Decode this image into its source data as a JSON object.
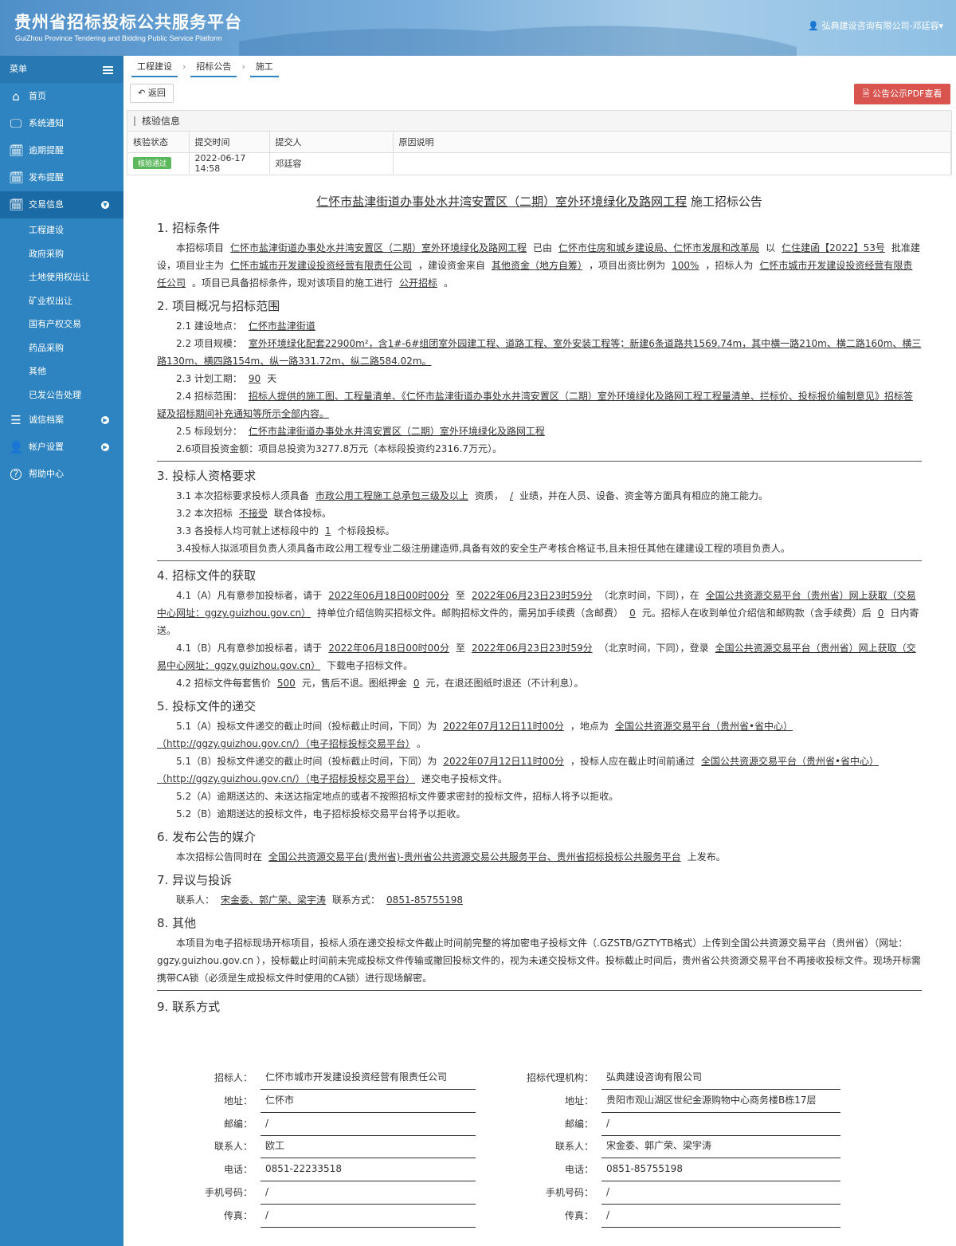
{
  "header": {
    "title": "贵州省招标投标公共服务平台",
    "subtitle": "GuiZhou Province Tendering and Bidding Public Service Platform",
    "user": "弘典建设咨询有限公司-邓廷容"
  },
  "sidebar": {
    "menu_label": "菜单",
    "items": [
      {
        "label": "首页",
        "icon": "home-icon"
      },
      {
        "label": "系统通知",
        "icon": "monitor-icon"
      },
      {
        "label": "逾期提醒",
        "icon": "calendar-icon"
      },
      {
        "label": "发布提醒",
        "icon": "calendar-icon"
      },
      {
        "label": "交易信息",
        "icon": "calendar-icon",
        "active": true
      }
    ],
    "sub_items": [
      "工程建设",
      "政府采购",
      "土地使用权出让",
      "矿业权出让",
      "国有产权交易",
      "药品采购",
      "其他",
      "已发公告处理"
    ],
    "items2": [
      {
        "label": "诚信档案",
        "icon": "list-icon"
      },
      {
        "label": "帐户设置",
        "icon": "user-icon"
      },
      {
        "label": "帮助中心",
        "icon": "help-icon"
      }
    ]
  },
  "breadcrumb": [
    "工程建设",
    "招标公告",
    "施工"
  ],
  "buttons": {
    "back": "返回",
    "pdf": "公告公示PDF查看"
  },
  "verify": {
    "title": "核验信息",
    "headers": [
      "核验状态",
      "提交时间",
      "提交人",
      "原因说明"
    ],
    "row": {
      "status": "核验通过",
      "time": "2022-06-17 14:58",
      "submitter": "邓廷容",
      "reason": ""
    }
  },
  "doc": {
    "title_project": "仁怀市盐津街道办事处水井湾安置区（二期）室外环境绿化及路网工程",
    "title_suffix": "施工招标公告",
    "s1": "1. 招标条件",
    "s1_p": [
      "本招标项目",
      "仁怀市盐津街道办事处水井湾安置区（二期）室外环境绿化及路网工程",
      "已由",
      "仁怀市住房和城乡建设局、仁怀市发展和改革局",
      "以",
      "仁住建函【2022】53号",
      "批准建设，项目业主为",
      "仁怀市城市开发建设投资经营有限责任公司",
      "，建设资金来自",
      "其他资金（地方自筹）",
      "，项目出资比例为",
      "100%",
      "，招标人为",
      "仁怀市城市开发建设投资经营有限责任公司",
      "。项目已具备招标条件，现对该项目的施工进行",
      "公开招标",
      "。"
    ],
    "s2": "2. 项目概况与招标范围",
    "s2_1": [
      "2.1  建设地点：",
      "仁怀市盐津街道"
    ],
    "s2_2": [
      "2.2  项目规模：",
      "室外环境绿化配套22900m²，含1#-6#组团室外园建工程、道路工程、室外安装工程等；新建6条道路共1569.74m，其中横一路210m、横二路160m、横三路130m、横四路154m、纵一路331.72m、纵二路584.02m。"
    ],
    "s2_3": [
      "2.3  计划工期：",
      "90",
      "天"
    ],
    "s2_4": [
      "2.4  招标范围：",
      "招标人提供的施工图、工程量清单、《仁怀市盐津街道办事处水井湾安置区（二期）室外环境绿化及路网工程工程量清单、拦标价、投标报价编制意见》招标答疑及招标期间补充通知等所示全部内容。"
    ],
    "s2_5": [
      "2.5  标段划分：",
      "仁怀市盐津街道办事处水井湾安置区（二期）室外环境绿化及路网工程"
    ],
    "s2_6": "2.6项目投资金额：项目总投资为3277.8万元（本标段投资约2316.7万元）。",
    "s3": "3. 投标人资格要求",
    "s3_1": [
      "3.1  本次招标要求投标人须具备",
      "市政公用工程施工总承包三级及以上",
      "资质，",
      "/",
      "业绩，并在人员、设备、资金等方面具有相应的施工能力。"
    ],
    "s3_2": [
      "3.2  本次招标",
      "不接受",
      "联合体投标。"
    ],
    "s3_3": [
      "3.3  各投标人均可就上述标段中的",
      "1",
      "个标段投标。"
    ],
    "s3_4": "3.4投标人拟派项目负责人须具备市政公用工程专业二级注册建造师,具备有效的安全生产考核合格证书,且未担任其他在建建设工程的项目负责人。",
    "s4": "4. 招标文件的获取",
    "s4_1a": [
      "4.1（A）凡有意参加投标者，请于",
      "2022年06月18日00时00分",
      "至",
      "2022年06月23日23时59分",
      "（北京时间，下同），在",
      "全国公共资源交易平台（贵州省）网上获取（交易中心网址：ggzy.guizhou.gov.cn）",
      "持单位介绍信购买招标文件。邮购招标文件的，需另加手续费（含邮费）",
      "0",
      "元。招标人在收到单位介绍信和邮购款（含手续费）后",
      "0",
      "日内寄送。"
    ],
    "s4_1b": [
      "4.1（B）凡有意参加投标者，请于",
      "2022年06月18日00时00分",
      "至",
      "2022年06月23日23时59分",
      "（北京时间，下同），登录",
      "全国公共资源交易平台（贵州省）网上获取（交易中心网址：ggzy.guizhou.gov.cn）",
      "下载电子招标文件。"
    ],
    "s4_2": [
      "4.2  招标文件每套售价",
      "500",
      "元，售后不退。图纸押金",
      "0",
      "元，在退还图纸时退还（不计利息）。"
    ],
    "s5": "5. 投标文件的递交",
    "s5_1a": [
      "5.1（A）投标文件递交的截止时间（投标截止时间，下同）为",
      "2022年07月12日11时00分",
      "，地点为",
      "全国公共资源交易平台（贵州省•省中心）（http://ggzy.guizhou.gov.cn/）（电子招标投标交易平台）",
      "。"
    ],
    "s5_1b": [
      "5.1（B）投标文件递交的截止时间（投标截止时间，下同）为",
      "2022年07月12日11时00分",
      "，投标人应在截止时间前通过",
      "全国公共资源交易平台（贵州省•省中心）（http://ggzy.guizhou.gov.cn/）（电子招标投标交易平台）",
      "递交电子投标文件。"
    ],
    "s5_2a": "5.2（A）逾期送达的、未送达指定地点的或者不按照招标文件要求密封的投标文件，招标人将予以拒收。",
    "s5_2b": "5.2（B）逾期送达的投标文件，电子招标投标交易平台将予以拒收。",
    "s6": "6. 发布公告的媒介",
    "s6_p": [
      "本次招标公告同时在",
      "全国公共资源交易平台(贵州省)-贵州省公共资源交易公共服务平台、贵州省招标投标公共服务平台",
      "上发布。"
    ],
    "s7": "7. 异议与投诉",
    "s7_p": [
      "联系人：",
      "宋金委、郭广荣、梁宇涛",
      "联系方式：",
      "0851-85755198"
    ],
    "s8": "8. 其他",
    "s8_p": "本项目为电子招标现场开标项目，投标人须在递交投标文件截止时间前完整的将加密电子投标文件（.GZSTB/GZTYTB格式）上传到全国公共资源交易平台（贵州省）（网址：ggzy.guizhou.gov.cn ），投标截止时间前未完成投标文件传输或撤回投标文件的，视为未递交投标文件。投标截止时间后，贵州省公共资源交易平台不再接收投标文件。现场开标需携带CA锁（必须是生成投标文件时使用的CA锁）进行现场解密。",
    "s9": "9. 联系方式"
  },
  "contacts": {
    "left": [
      [
        "招标人：",
        "仁怀市城市开发建设投资经营有限责任公司"
      ],
      [
        "地址：",
        "仁怀市"
      ],
      [
        "邮编：",
        "/"
      ],
      [
        "联系人：",
        "欧工"
      ],
      [
        "电话：",
        "0851-22233518"
      ],
      [
        "手机号码：",
        "/"
      ],
      [
        "传真：",
        "/"
      ]
    ],
    "right": [
      [
        "招标代理机构：",
        "弘典建设咨询有限公司"
      ],
      [
        "地址：",
        "贵阳市观山湖区世纪金源购物中心商务楼B栋17层"
      ],
      [
        "邮编：",
        "/"
      ],
      [
        "联系人：",
        "宋金委、郭广荣、梁宇涛"
      ],
      [
        "电话：",
        "0851-85755198"
      ],
      [
        "手机号码：",
        "/"
      ],
      [
        "传真：",
        "/"
      ]
    ]
  }
}
